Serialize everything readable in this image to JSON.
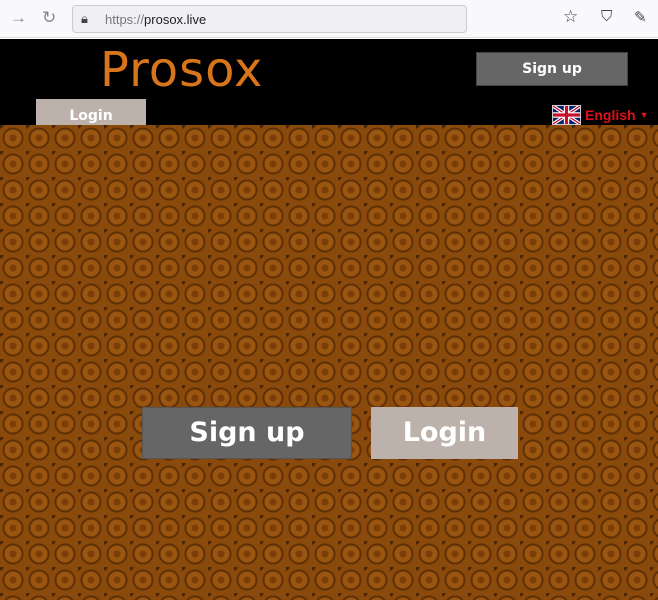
{
  "browser": {
    "url_protocol": "https://",
    "url_host": "prosox.live"
  },
  "header": {
    "logo": "Prosox",
    "signup_label": "Sign up",
    "login_label": "Login",
    "language": "English"
  },
  "main": {
    "signup_label": "Sign up",
    "login_label": "Login"
  },
  "colors": {
    "logo": "#d8751a",
    "language": "#e0101a",
    "signup_bg": "#666666",
    "login_bg": "#bdb2ab",
    "pattern": "#8a4a0c"
  }
}
